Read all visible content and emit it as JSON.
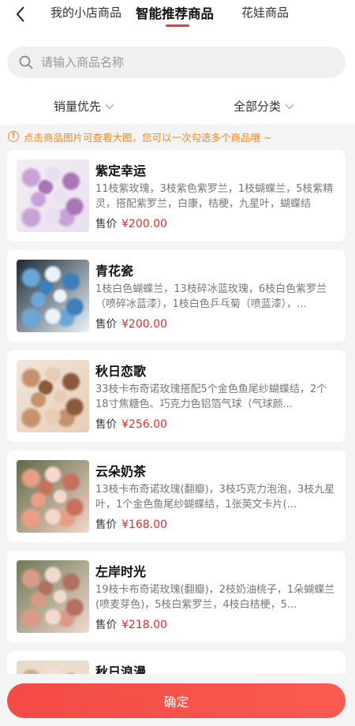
{
  "tabs": [
    {
      "label": "我的小店商品"
    },
    {
      "label": "智能推荐商品"
    },
    {
      "label": "花娃商品"
    }
  ],
  "search": {
    "placeholder": "请输入商品名称"
  },
  "filters": [
    {
      "label": "销量优先"
    },
    {
      "label": "全部分类"
    }
  ],
  "tip": {
    "text": "点击商品图片可查看大图，您可以一次勾选多个商品哦 ~"
  },
  "products": [
    {
      "name": "紫定幸运",
      "desc": "11枝紫玫瑰，3枝紫色紫罗兰，1枝蝴蝶兰，5枝紫精灵，搭配紫罗兰，白康，桔梗，九星叶，蝴蝶结",
      "price_label": "售价",
      "price": "¥200.00",
      "colors": [
        "#c7a2d6",
        "#e9e0ef",
        "#a777b5",
        "#f2eef4"
      ]
    },
    {
      "name": "青花瓷",
      "desc": "1枝白色蝴蝶兰，13枝碎冰蓝玫瑰，6枝白色紫罗兰（喷碎冰蓝漆），1枝白色乒乓菊（喷蓝漆），...",
      "price_label": "售价",
      "price": "¥200.00",
      "colors": [
        "#6aa7d6",
        "#eaf2f8",
        "#3d7fb8",
        "#1b2a3a"
      ]
    },
    {
      "name": "秋日恋歌",
      "desc": "33枝卡布奇诺玫瑰搭配5个金色鱼尾纱蝴蝶结，2个18寸焦糖色、巧克力色铝箔气球（气球颜...",
      "price_label": "售价",
      "price": "¥256.00",
      "colors": [
        "#c4926c",
        "#e8cdb5",
        "#8a5a3c",
        "#f1e6dc"
      ]
    },
    {
      "name": "云朵奶茶",
      "desc": "13枝卡布奇诺玫瑰(翻瓣)，3枝巧克力泡泡，3枝九星叶，1个金色鱼尾纱蝴蝶结，1张英文卡片(...",
      "price_label": "售价",
      "price": "¥168.00",
      "colors": [
        "#e99d87",
        "#f6d6cb",
        "#c9705c",
        "#5e6b45"
      ]
    },
    {
      "name": "左岸时光",
      "desc": "19枝卡布奇诺玫瑰(翻瓣)，2枝奶油桃子，1朵蝴蝶兰(喷麦芽色)，5枝白紫罗兰，4枝白桔梗，5...",
      "price_label": "售价",
      "price": "¥218.00",
      "colors": [
        "#d89b88",
        "#f0d9cf",
        "#b36f5f",
        "#6f7a55"
      ]
    },
    {
      "name": "秋日浪漫",
      "desc": "",
      "price_label": "售价",
      "price": "",
      "colors": [
        "#cfa98a",
        "#efe0d2",
        "#9b7356",
        "#e8d9c8"
      ]
    }
  ],
  "confirm_label": "确定",
  "accent_color": "#e93a3a"
}
